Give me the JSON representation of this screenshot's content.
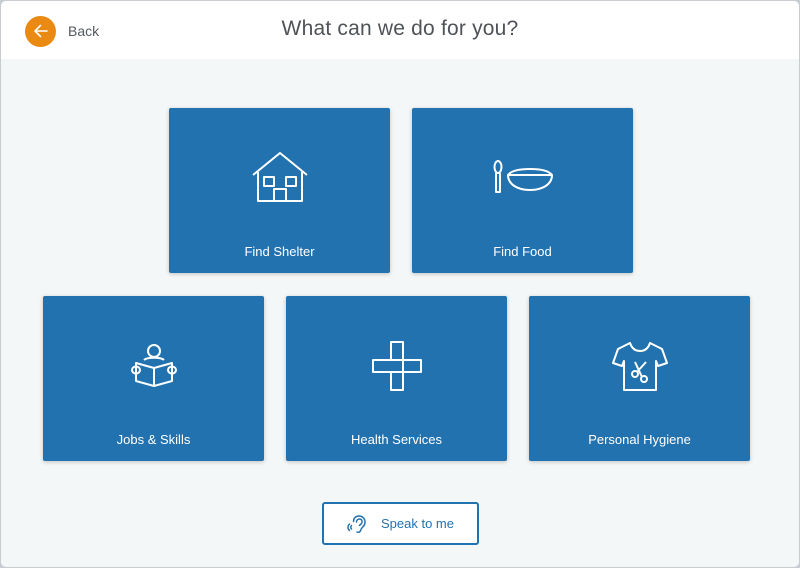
{
  "header": {
    "back_label": "Back",
    "title": "What can we do for you?"
  },
  "tiles": [
    {
      "label": "Find Shelter",
      "icon": "house-icon"
    },
    {
      "label": "Find Food",
      "icon": "spoon-bowl-icon"
    },
    {
      "label": "Jobs & Skills",
      "icon": "person-reading-icon"
    },
    {
      "label": "Health Services",
      "icon": "medical-cross-icon"
    },
    {
      "label": "Personal Hygiene",
      "icon": "shirt-scissors-icon"
    }
  ],
  "speak": {
    "label": "Speak to me",
    "icon": "ear-sound-icon"
  },
  "colors": {
    "accent_orange": "#ea8a12",
    "tile_blue": "#2272b0",
    "background": "#f4f7f8",
    "header_bg": "#ffffff"
  }
}
